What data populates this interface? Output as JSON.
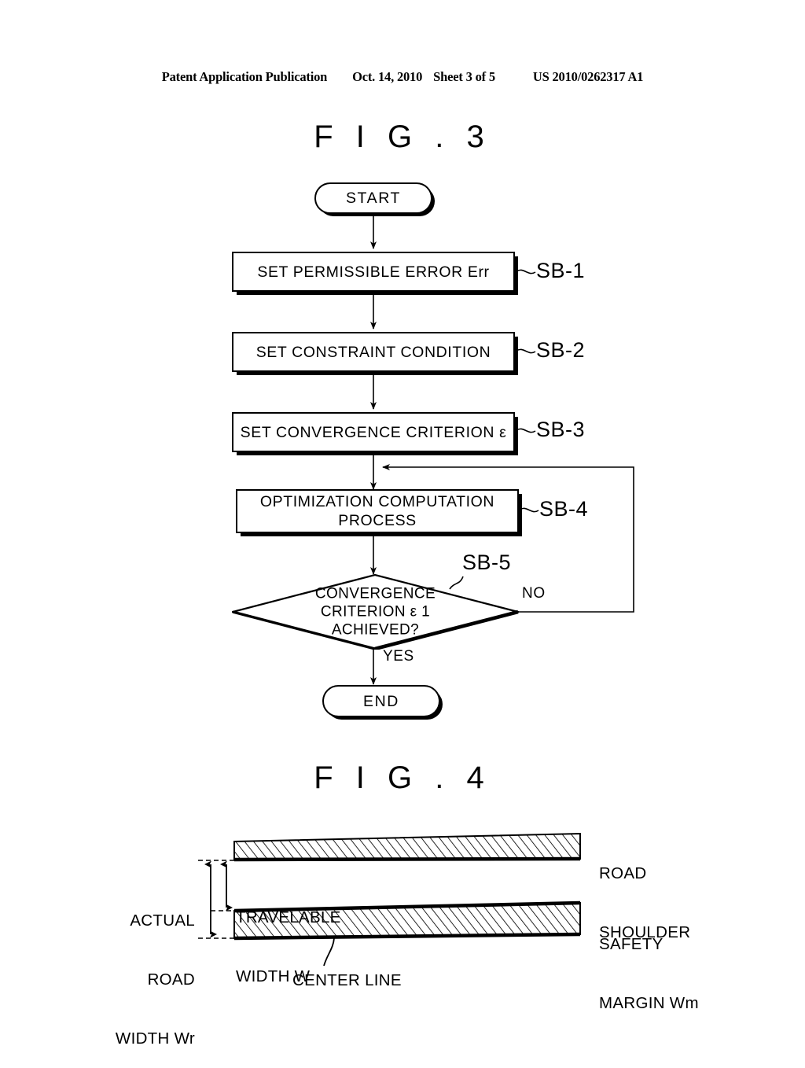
{
  "header": {
    "publication": "Patent Application Publication",
    "date": "Oct. 14, 2010",
    "sheet": "Sheet 3 of 5",
    "number": "US 2010/0262317 A1"
  },
  "figures": [
    {
      "id": "fig3",
      "title": "F I G . 3",
      "type": "flowchart",
      "nodes": [
        {
          "id": "start",
          "shape": "terminator",
          "label": "START"
        },
        {
          "id": "sb1",
          "shape": "process",
          "label": "SET PERMISSIBLE ERROR Err",
          "ref": "SB-1"
        },
        {
          "id": "sb2",
          "shape": "process",
          "label": "SET CONSTRAINT CONDITION",
          "ref": "SB-2"
        },
        {
          "id": "sb3",
          "shape": "process",
          "label": "SET CONVERGENCE CRITERION ε",
          "ref": "SB-3"
        },
        {
          "id": "sb4",
          "shape": "process",
          "label_line1": "OPTIMIZATION COMPUTATION",
          "label_line2": "PROCESS",
          "ref": "SB-4"
        },
        {
          "id": "sb5",
          "shape": "decision",
          "label_line1": "CONVERGENCE",
          "label_line2": "CRITERION ε 1",
          "label_line3": "ACHIEVED?",
          "ref": "SB-5"
        },
        {
          "id": "end",
          "shape": "terminator",
          "label": "END"
        }
      ],
      "branches": {
        "no": "NO",
        "yes": "YES"
      }
    },
    {
      "id": "fig4",
      "title": "F I G . 4",
      "type": "road-cross-section",
      "labels": {
        "road_shoulder_line1": "ROAD",
        "road_shoulder_line2": "SHOULDER",
        "safety_margin_line1": "SAFETY",
        "safety_margin_line2": "MARGIN Wm",
        "actual_road_width_line1": "ACTUAL",
        "actual_road_width_line2": "ROAD",
        "actual_road_width_line3": "WIDTH Wr",
        "travelable_width_line1": "TRAVELABLE",
        "travelable_width_line2": "WIDTH W",
        "center_line": "CENTER LINE"
      }
    }
  ]
}
